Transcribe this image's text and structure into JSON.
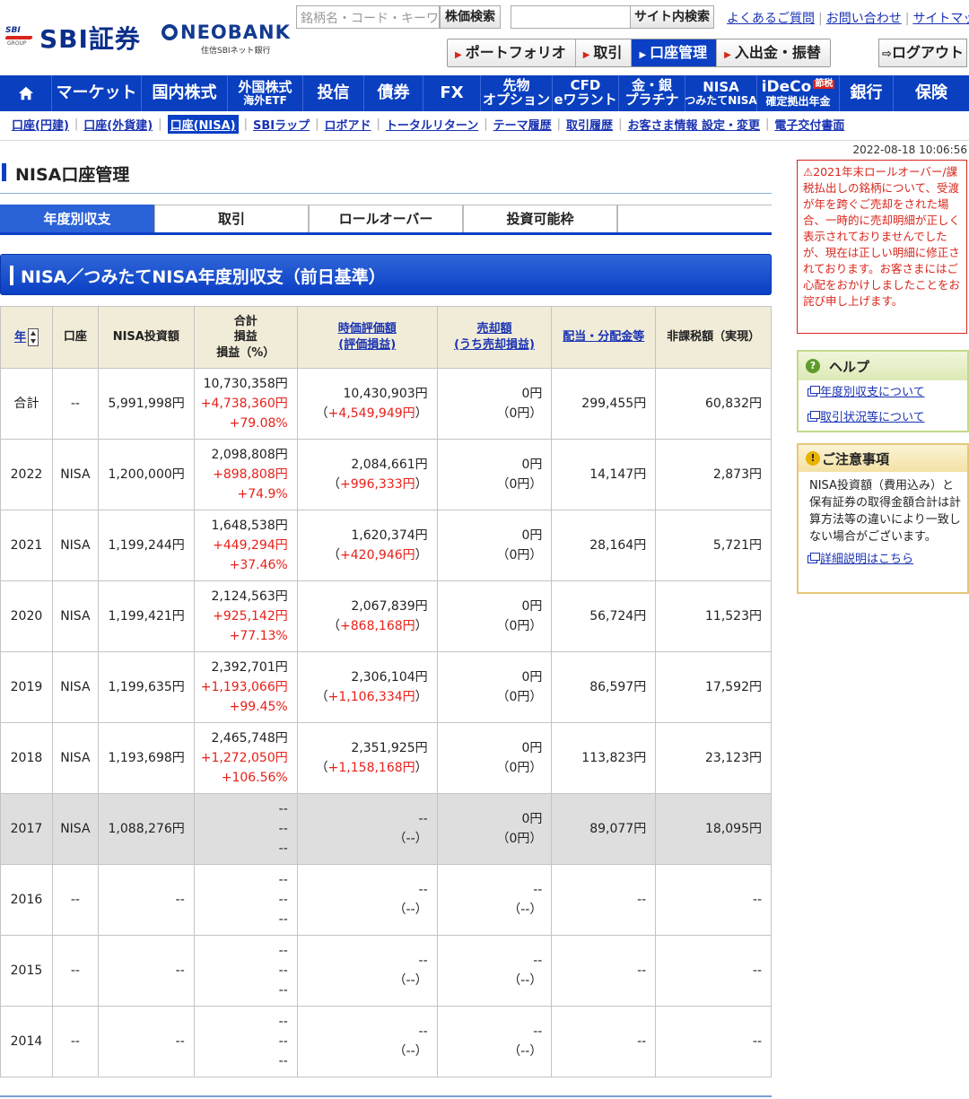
{
  "header": {
    "logo_sbi": "SBI証券",
    "logo_sbi_mark": "SBI",
    "logo_sbi_group": "GROUP",
    "logo_neobank": "NEOBANK",
    "logo_neobank_sub": "住信SBIネット銀行",
    "search_placeholder": "銘柄名・コード・キーワード",
    "stock_search_button": "株価検索",
    "site_search_button": "サイト内検索",
    "links": [
      "よくあるご質問",
      "お問い合わせ",
      "サイトマップ"
    ],
    "subnav": [
      "ポートフォリオ",
      "取引",
      "口座管理",
      "入出金・振替"
    ],
    "subnav_active": 2,
    "logout": "ログアウト"
  },
  "mainnav": {
    "market": "マーケット",
    "domestic": "国内株式",
    "foreign_l1": "外国株式",
    "foreign_l2": "海外ETF",
    "fund": "投信",
    "bond": "債券",
    "fx": "FX",
    "futures_l1": "先物",
    "futures_l2": "オプション",
    "cfd_l1": "CFD",
    "cfd_l2": "eワラント",
    "gold_l1": "金・銀",
    "gold_l2": "プラチナ",
    "nisa_l1": "NISA",
    "nisa_l2": "つみたてNISA",
    "ideco_l1": "iDeCo",
    "ideco_badge": "節税",
    "ideco_l2": "確定拠出年金",
    "bank": "銀行",
    "insurance": "保険"
  },
  "account_links": [
    "口座(円建)",
    "口座(外貨建)",
    "口座(NISA)",
    "SBIラップ",
    "ロボアド",
    "トータルリターン",
    "テーマ履歴",
    "取引履歴",
    "お客さま情報 設定・変更",
    "電子交付書面"
  ],
  "timestamp": "2022-08-18 10:06:56",
  "page_title": "NISA口座管理",
  "tabs": [
    "年度別収支",
    "取引",
    "ロールオーバー",
    "投資可能枠"
  ],
  "section_title": "NISA／つみたてNISA年度別収支（前日基準）",
  "table": {
    "headers": {
      "year": "年",
      "account": "口座",
      "invest": "NISA投資額",
      "total_l1": "合計",
      "total_l2": "損益",
      "total_l3": "損益（%）",
      "market_l1": "時価評価額",
      "market_l2": "(評価損益)",
      "sale_l1": "売却額",
      "sale_l2": "(うち売却損益)",
      "dividend": "配当・分配金等",
      "taxfree": "非課税額（実現）"
    },
    "rows": [
      {
        "year": "合計",
        "account": "--",
        "invest": "5,991,998円",
        "total": "10,730,358円",
        "pl": "+4,738,360円",
        "pct": "+79.08%",
        "market": "10,430,903円",
        "eval_pl": "+4,549,949円",
        "sale": "0円",
        "sale_pl": "0円",
        "dividend": "299,455円",
        "taxfree": "60,832円"
      },
      {
        "year": "2022",
        "account": "NISA",
        "invest": "1,200,000円",
        "total": "2,098,808円",
        "pl": "+898,808円",
        "pct": "+74.9%",
        "market": "2,084,661円",
        "eval_pl": "+996,333円",
        "sale": "0円",
        "sale_pl": "0円",
        "dividend": "14,147円",
        "taxfree": "2,873円"
      },
      {
        "year": "2021",
        "account": "NISA",
        "invest": "1,199,244円",
        "total": "1,648,538円",
        "pl": "+449,294円",
        "pct": "+37.46%",
        "market": "1,620,374円",
        "eval_pl": "+420,946円",
        "sale": "0円",
        "sale_pl": "0円",
        "dividend": "28,164円",
        "taxfree": "5,721円"
      },
      {
        "year": "2020",
        "account": "NISA",
        "invest": "1,199,421円",
        "total": "2,124,563円",
        "pl": "+925,142円",
        "pct": "+77.13%",
        "market": "2,067,839円",
        "eval_pl": "+868,168円",
        "sale": "0円",
        "sale_pl": "0円",
        "dividend": "56,724円",
        "taxfree": "11,523円"
      },
      {
        "year": "2019",
        "account": "NISA",
        "invest": "1,199,635円",
        "total": "2,392,701円",
        "pl": "+1,193,066円",
        "pct": "+99.45%",
        "market": "2,306,104円",
        "eval_pl": "+1,106,334円",
        "sale": "0円",
        "sale_pl": "0円",
        "dividend": "86,597円",
        "taxfree": "17,592円"
      },
      {
        "year": "2018",
        "account": "NISA",
        "invest": "1,193,698円",
        "total": "2,465,748円",
        "pl": "+1,272,050円",
        "pct": "+106.56%",
        "market": "2,351,925円",
        "eval_pl": "+1,158,168円",
        "sale": "0円",
        "sale_pl": "0円",
        "dividend": "113,823円",
        "taxfree": "23,123円"
      },
      {
        "year": "2017",
        "account": "NISA",
        "invest": "1,088,276円",
        "total": "--",
        "pl": "--",
        "pct": "--",
        "market": "--",
        "eval_pl": "--",
        "sale": "0円",
        "sale_pl": "0円",
        "dividend": "89,077円",
        "taxfree": "18,095円",
        "grey": true
      },
      {
        "year": "2016",
        "account": "--",
        "invest": "--",
        "total": "--",
        "pl": "--",
        "pct": "--",
        "market": "--",
        "eval_pl": "--",
        "sale": "--",
        "sale_pl": "--",
        "dividend": "--",
        "taxfree": "--"
      },
      {
        "year": "2015",
        "account": "--",
        "invest": "--",
        "total": "--",
        "pl": "--",
        "pct": "--",
        "market": "--",
        "eval_pl": "--",
        "sale": "--",
        "sale_pl": "--",
        "dividend": "--",
        "taxfree": "--"
      },
      {
        "year": "2014",
        "account": "--",
        "invest": "--",
        "total": "--",
        "pl": "--",
        "pct": "--",
        "market": "--",
        "eval_pl": "--",
        "sale": "--",
        "sale_pl": "--",
        "dividend": "--",
        "taxfree": "--"
      }
    ]
  },
  "sidebar": {
    "notice": "2021年末ロールオーバー/課税払出しの銘柄について、受渡が年を跨ぐご売却をされた場合、一時的に売却明細が正しく表示されておりませんでしたが、現在は正しい明細に修正されております。お客さまにはご心配をおかけしましたことをお詫び申し上げます。",
    "help_title": "ヘルプ",
    "help_links": [
      "年度別収支について",
      "取引状況等について"
    ],
    "caution_title": "ご注意事項",
    "caution_body": "NISA投資額（費用込み）と保有証券の取得金額合計は計算方法等の違いにより一致しない場合がございます。",
    "caution_link": "詳細説明はこちら"
  },
  "colors": {
    "brand_blue": "#0a3fbf",
    "tab_active": "#2a62d8",
    "profit_red": "#e8201a",
    "notice_red": "#d9261c"
  }
}
